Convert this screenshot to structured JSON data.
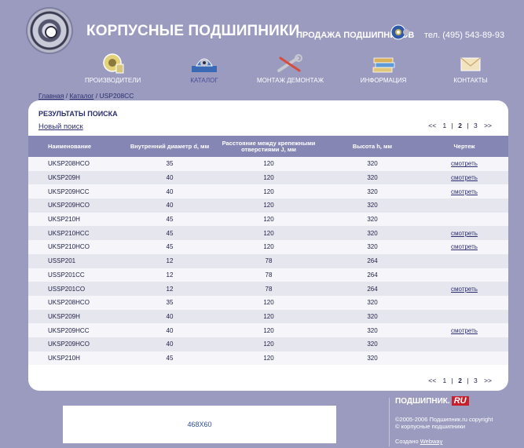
{
  "header": {
    "brand": "КОРПУСНЫЕ ПОДШИПНИКИ",
    "sale": "ПРОДАЖА ПОДШИПНИКОВ",
    "phone": "тел. (495) 543-89-93"
  },
  "nav": [
    {
      "label": "ПРОИЗВОДИТЕЛИ",
      "icon": "gear-badge-icon"
    },
    {
      "label": "КАТАЛОГ",
      "icon": "bearing-unit-icon",
      "active": true
    },
    {
      "label": "МОНТАЖ ДЕМОНТАЖ",
      "icon": "wrench-icon"
    },
    {
      "label": "ИНФОРМАЦИЯ",
      "icon": "books-icon"
    },
    {
      "label": "КОНТАКТЫ",
      "icon": "envelope-icon"
    }
  ],
  "breadcrumb": {
    "home": "Главная",
    "catalog": "Каталог",
    "current": "USP208CC"
  },
  "results": {
    "title": "РЕЗУЛЬТАТЫ ПОИСКА",
    "new_search": "Новый поиск"
  },
  "pager": {
    "prev": "<<",
    "pages": [
      "1",
      "2",
      "3"
    ],
    "current": "2",
    "next": ">>"
  },
  "table": {
    "headers": [
      "Наименование",
      "Внутренний диаметр d, мм",
      "Расстояние между крепежными отверстиями J, мм",
      "Высота h, мм",
      "Чертеж"
    ],
    "link_label": "смотреть",
    "rows": [
      {
        "name": "UKSP208HCO",
        "d": "35",
        "j": "120",
        "h": "320",
        "drawing": true
      },
      {
        "name": "UKSP209H",
        "d": "40",
        "j": "120",
        "h": "320",
        "drawing": true
      },
      {
        "name": "UKSP209HCC",
        "d": "40",
        "j": "120",
        "h": "320",
        "drawing": true
      },
      {
        "name": "UKSP209HCO",
        "d": "40",
        "j": "120",
        "h": "320",
        "drawing": false
      },
      {
        "name": "UKSP210H",
        "d": "45",
        "j": "120",
        "h": "320",
        "drawing": false
      },
      {
        "name": "UKSP210HCC",
        "d": "45",
        "j": "120",
        "h": "320",
        "drawing": true
      },
      {
        "name": "UKSP210HCO",
        "d": "45",
        "j": "120",
        "h": "320",
        "drawing": true
      },
      {
        "name": "USSP201",
        "d": "12",
        "j": "78",
        "h": "264",
        "drawing": false
      },
      {
        "name": "USSP201CC",
        "d": "12",
        "j": "78",
        "h": "264",
        "drawing": false
      },
      {
        "name": "USSP201CO",
        "d": "12",
        "j": "78",
        "h": "264",
        "drawing": true
      },
      {
        "name": "UKSP208HCO",
        "d": "35",
        "j": "120",
        "h": "320",
        "drawing": false
      },
      {
        "name": "UKSP209H",
        "d": "40",
        "j": "120",
        "h": "320",
        "drawing": false
      },
      {
        "name": "UKSP209HCC",
        "d": "40",
        "j": "120",
        "h": "320",
        "drawing": true
      },
      {
        "name": "UKSP209HCO",
        "d": "40",
        "j": "120",
        "h": "320",
        "drawing": false
      },
      {
        "name": "UKSP210H",
        "d": "45",
        "j": "120",
        "h": "320",
        "drawing": false
      }
    ]
  },
  "banner": {
    "text": "468X60"
  },
  "footer": {
    "logo_text": "ПОДШИПНИК.",
    "logo_ru": "RU",
    "copyright_1": "©2005-2006 Подшипник.ru copyright",
    "copyright_2": "© корпусные подшипники",
    "made_by": "Создано",
    "made_by_link": "Webway"
  },
  "colors": {
    "background": "#9a9bbf",
    "header_row": "#8586b3",
    "row_light": "#f6f6fa",
    "row_dark": "#e6e7ee",
    "link": "#2c2e70"
  }
}
